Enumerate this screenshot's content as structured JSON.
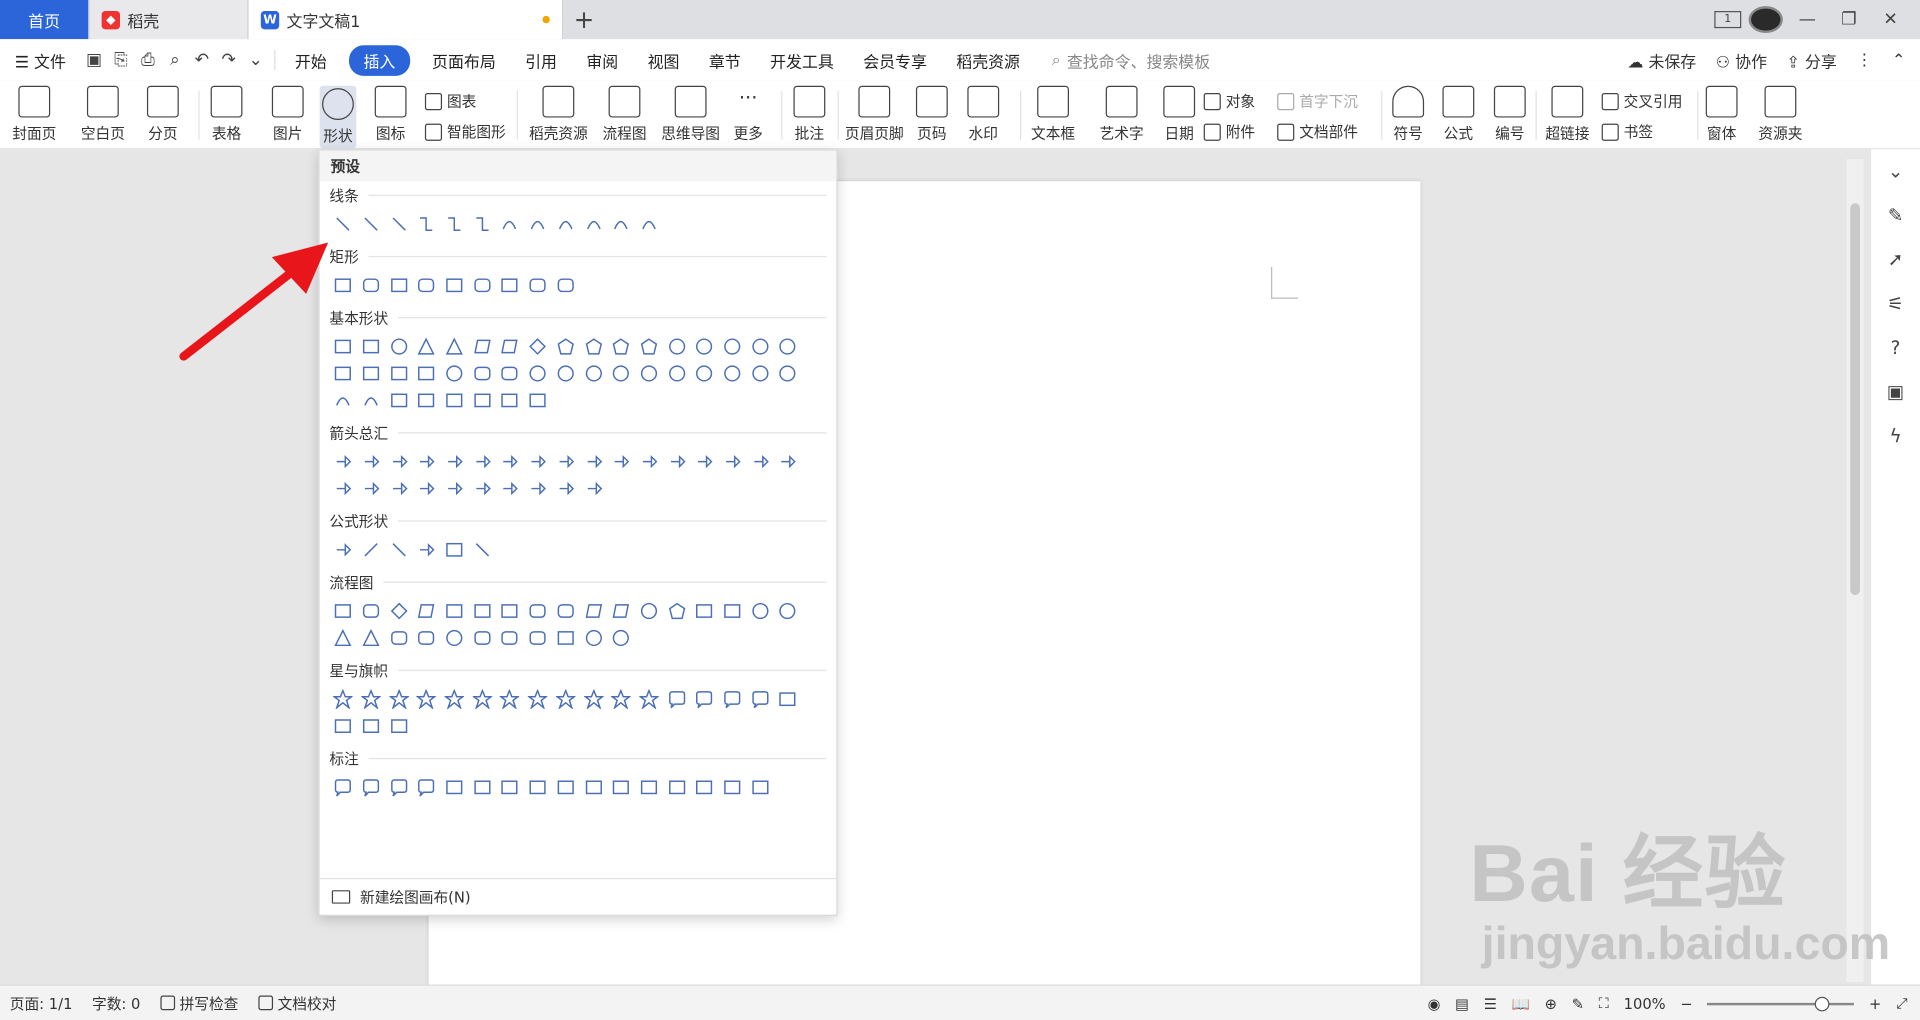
{
  "tabs": {
    "home": "首页",
    "daoke": "稻壳",
    "doc": "文字文稿1"
  },
  "window": {
    "layout_badge": "1"
  },
  "menubar": {
    "file": "文件",
    "items": [
      "开始",
      "插入",
      "页面布局",
      "引用",
      "审阅",
      "视图",
      "章节",
      "开发工具",
      "会员专享",
      "稻壳资源"
    ],
    "search_placeholder": "查找命令、搜索模板",
    "unsaved": "未保存",
    "collab": "协作",
    "share": "分享"
  },
  "ribbon": {
    "cover": "封面页",
    "blank": "空白页",
    "pagebreak": "分页",
    "table": "表格",
    "picture": "图片",
    "shape": "形状",
    "icons": "图标",
    "chart": "图表",
    "smart": "智能图形",
    "daoke_res": "稻壳资源",
    "flow": "流程图",
    "mindmap": "思维导图",
    "more": "更多",
    "comment": "批注",
    "header_footer": "页眉页脚",
    "page_no": "页码",
    "watermark": "水印",
    "textbox": "文本框",
    "wordart": "艺术字",
    "date": "日期",
    "object": "对象",
    "attach": "附件",
    "dropcap": "首字下沉",
    "docpart": "文档部件",
    "symbol": "符号",
    "formula": "公式",
    "numbering": "编号",
    "hyperlink": "超链接",
    "crossref": "交叉引用",
    "bookmark": "书签",
    "window": "窗体",
    "library": "资源夹"
  },
  "shapes_menu": {
    "preset": "预设",
    "sections": [
      {
        "title": "线条",
        "count": 12
      },
      {
        "title": "矩形",
        "count": 9
      },
      {
        "title": "基本形状",
        "count": 42
      },
      {
        "title": "箭头总汇",
        "count": 27
      },
      {
        "title": "公式形状",
        "count": 6
      },
      {
        "title": "流程图",
        "count": 28
      },
      {
        "title": "星与旗帜",
        "count": 20
      },
      {
        "title": "标注",
        "count": 16
      }
    ],
    "new_canvas": "新建绘图画布(N)"
  },
  "status": {
    "page": "页面: 1/1",
    "words": "字数: 0",
    "spell": "拼写检查",
    "proof": "文档校对",
    "zoom": "100%"
  },
  "watermark_text": {
    "main": "Bai  经验",
    "sub": "jingyan.baidu.com"
  },
  "colors": {
    "accent": "#2b65d9",
    "arrow": "#e8161b",
    "shape_stroke": "#4a6fb5"
  }
}
